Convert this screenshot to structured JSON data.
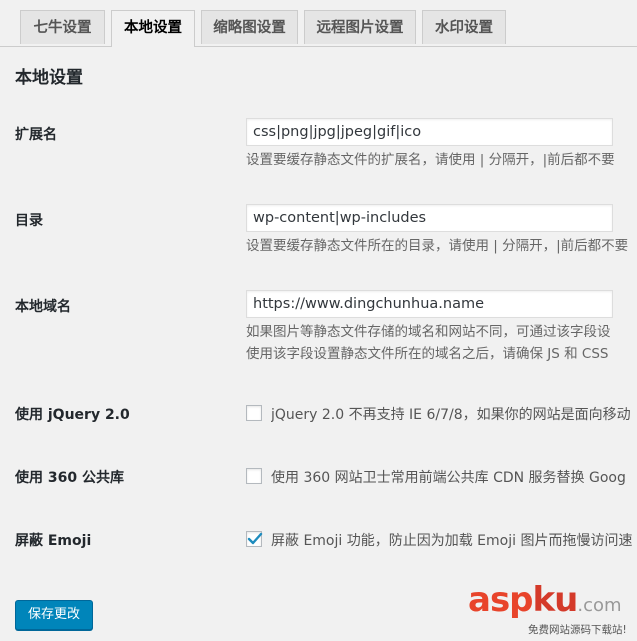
{
  "tabs": [
    {
      "label": "七牛设置",
      "active": false
    },
    {
      "label": "本地设置",
      "active": true
    },
    {
      "label": "缩略图设置",
      "active": false
    },
    {
      "label": "远程图片设置",
      "active": false
    },
    {
      "label": "水印设置",
      "active": false
    }
  ],
  "page_title": "本地设置",
  "fields": {
    "extensions": {
      "label": "扩展名",
      "value": "css|png|jpg|jpeg|gif|ico",
      "description": "设置要缓存静态文件的扩展名，请使用 | 分隔开，|前后都不要"
    },
    "directories": {
      "label": "目录",
      "value": "wp-content|wp-includes",
      "description": "设置要缓存静态文件所在的目录，请使用 | 分隔开，|前后都不要"
    },
    "local_domain": {
      "label": "本地域名",
      "value": "https://www.dingchunhua.name",
      "description_line1": "如果图片等静态文件存储的域名和网站不同，可通过该字段设",
      "description_line2": "使用该字段设置静态文件所在的域名之后，请确保 JS 和 CSS"
    }
  },
  "options": {
    "jquery": {
      "label": "使用 jQuery 2.0",
      "text": "jQuery 2.0 不再支持 IE 6/7/8，如果你的网站是面向移动",
      "checked": false
    },
    "cdn360": {
      "label": "使用 360 公共库",
      "text": "使用 360 网站卫士常用前端公共库 CDN 服务替换 Goog",
      "checked": false
    },
    "emoji": {
      "label": "屏蔽 Emoji",
      "text": "屏蔽 Emoji 功能，防止因为加载 Emoji 图片而拖慢访问速",
      "checked": true
    }
  },
  "save_label": "保存更改",
  "watermark": {
    "asp": "asp",
    "ku": "ku",
    "com": ".com",
    "sub": "免费网站源码下载站!"
  },
  "colors": {
    "primary_button": "#0085ba",
    "checkmark": "#1e8cbe",
    "background": "#f1f1f1"
  }
}
